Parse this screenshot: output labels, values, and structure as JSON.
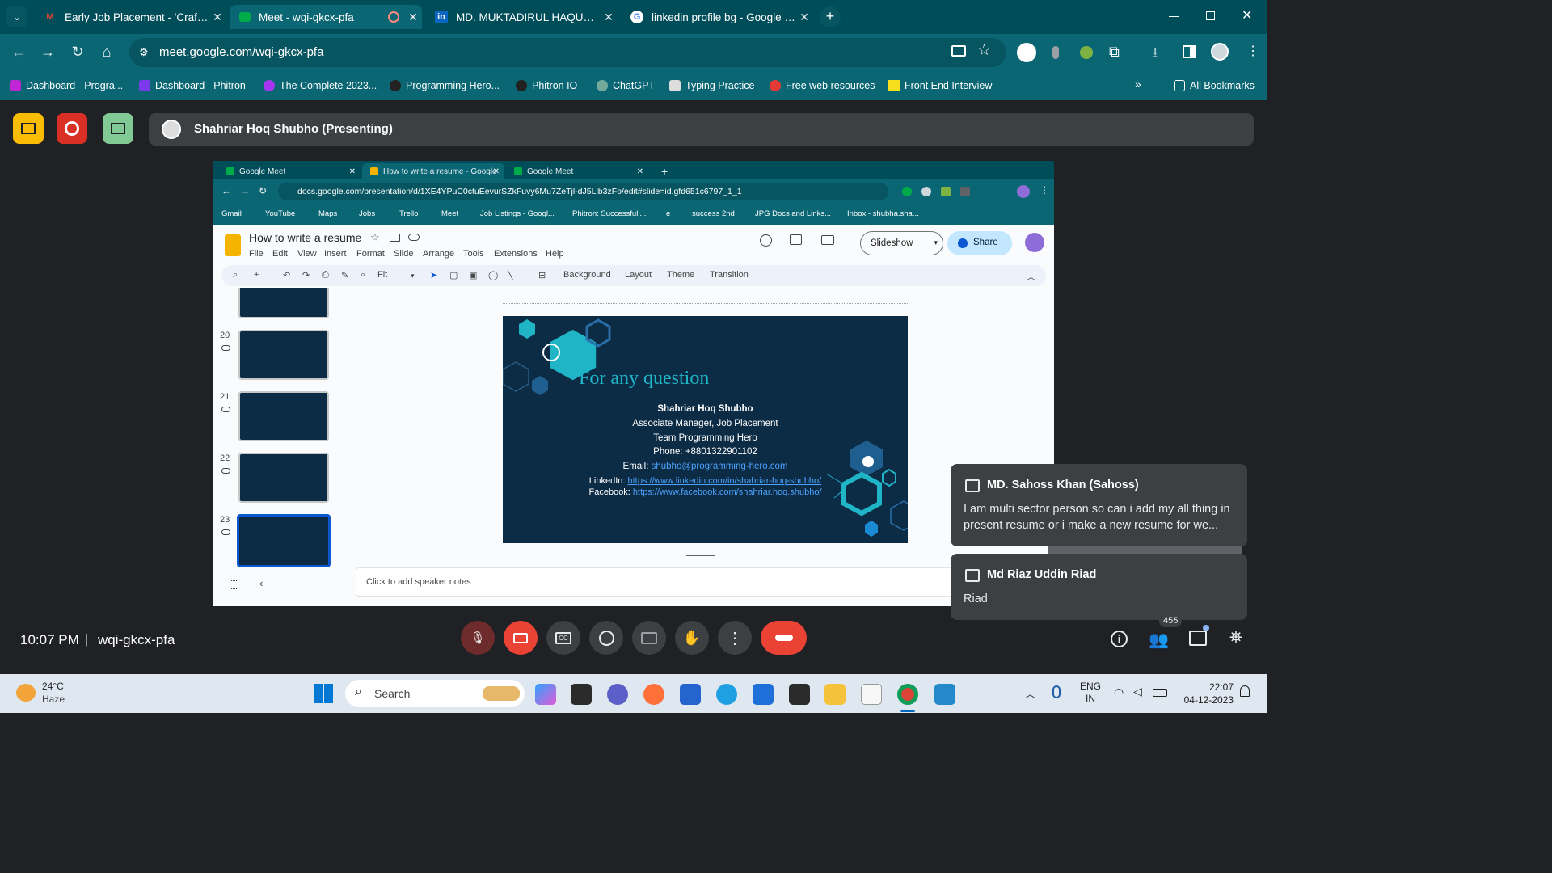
{
  "browser": {
    "tabs": [
      {
        "title": "Early Job Placement - 'Crafting y",
        "icon": "gmail-icon",
        "color": "#ea4335"
      },
      {
        "title": "Meet - wqi-gkcx-pfa",
        "icon": "meet-icon",
        "color": "#00ac47"
      },
      {
        "title": "MD. MUKTADIRUL HAQUE MA",
        "icon": "linkedin-icon",
        "color": "#0a66c2"
      },
      {
        "title": "linkedin profile bg - Google Sea",
        "icon": "google-icon",
        "color": "#4285f4"
      }
    ],
    "url": "meet.google.com/wqi-gkcx-pfa",
    "bookmarks": [
      {
        "label": "Dashboard - Progra...",
        "color": "#c026d3"
      },
      {
        "label": "Dashboard - Phitron",
        "color": "#7c3aed"
      },
      {
        "label": "The Complete 2023...",
        "color": "#a435f0"
      },
      {
        "label": "Programming Hero...",
        "color": "#222222"
      },
      {
        "label": "Phitron IO",
        "color": "#222222"
      },
      {
        "label": "ChatGPT",
        "color": "#74aa9c"
      },
      {
        "label": "Typing Practice",
        "color": "#dddddd"
      },
      {
        "label": "Free web resources",
        "color": "#e53935"
      },
      {
        "label": "Front End Interview",
        "color": "#f7df1e"
      }
    ],
    "all_bookmarks": "All Bookmarks"
  },
  "meet": {
    "presenter": "Shahriar Hoq Shubho (Presenting)",
    "time": "10:07 PM",
    "divider": "|",
    "code": "wqi-gkcx-pfa",
    "participants_badge": "455",
    "chats": [
      {
        "author": "MD. Sahoss Khan (Sahoss)",
        "text": "I am multi sector person so can i add my all thing in present resume or i make a new resume for we..."
      },
      {
        "author": "Md Riaz Uddin Riad",
        "text": "Riad"
      }
    ]
  },
  "shared": {
    "tabs": [
      "Google Meet",
      "How to write a resume - Google",
      "Google Meet"
    ],
    "url": "docs.google.com/presentation/d/1XE4YPuC0ctuEevurSZkFuvy6Mu7ZeTjl-dJ5Llb3zFo/edit#slide=id.gfd651c6797_1_1",
    "bookmarks": [
      "Gmail",
      "YouTube",
      "Maps",
      "Jobs",
      "Trello",
      "Meet",
      "Job Listings - Googl...",
      "Phitron: Successfull...",
      "e",
      "success 2nd",
      "JPG Docs and Links...",
      "Inbox - shubha.sha..."
    ],
    "doc_title": "How to write a resume",
    "menus": [
      "File",
      "Edit",
      "View",
      "Insert",
      "Format",
      "Slide",
      "Arrange",
      "Tools",
      "Extensions",
      "Help"
    ],
    "slideshow": "Slideshow",
    "share": "Share",
    "zoom": "Fit",
    "toolbar_items": [
      "Background",
      "Layout",
      "Theme",
      "Transition"
    ],
    "slide_numbers": [
      "20",
      "21",
      "22",
      "23"
    ],
    "speaker_notes": "Click to add speaker notes",
    "slide": {
      "heading": "For any question",
      "name": "Shahriar Hoq Shubho",
      "role": "Associate Manager, Job Placement",
      "team": "Team Programming Hero",
      "phone": "Phone: +8801322901102",
      "email_label": "Email: ",
      "email": "shubho@programming-hero.com",
      "linkedin_label": "LinkedIn: ",
      "linkedin": "https://www.linkedin.com/in/shahriar-hoq-shubho/",
      "facebook_label": "Facebook: ",
      "facebook": "https://www.facebook.com/shahriar.hoq.shubho/"
    }
  },
  "taskbar": {
    "temp": "24°C",
    "weather": "Haze",
    "search": "Search",
    "lang1": "ENG",
    "lang2": "IN",
    "clock": "22:07",
    "date": "04-12-2023"
  }
}
